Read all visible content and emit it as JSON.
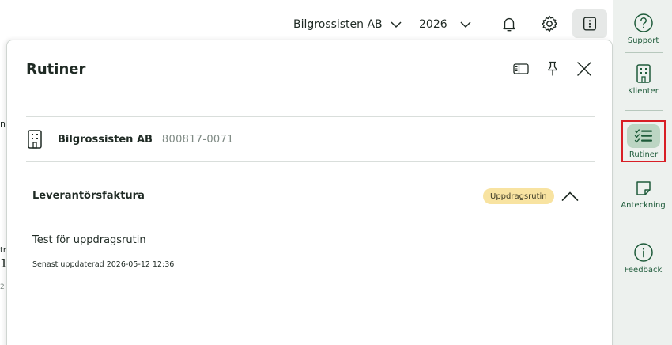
{
  "topbar": {
    "company": "Bilgrossisten AB",
    "year": "2026"
  },
  "background": {
    "fragments": [
      "n",
      "tr",
      "1",
      "2"
    ]
  },
  "rail": {
    "items": [
      {
        "label": "Support",
        "icon": "question-circle-icon"
      },
      {
        "label": "Klienter",
        "icon": "building-icon"
      },
      {
        "label": "Rutiner",
        "icon": "checklist-icon",
        "active": true
      },
      {
        "label": "Anteckning",
        "icon": "note-icon"
      },
      {
        "label": "Feedback",
        "icon": "info-circle-icon"
      }
    ]
  },
  "panel": {
    "title": "Rutiner",
    "client": {
      "name": "Bilgrossisten AB",
      "org_number": "800817-0071"
    },
    "routine": {
      "title": "Leverantörsfaktura",
      "badge": "Uppdragsrutin",
      "text": "Test för uppdragsrutin",
      "updated": "Senast uppdaterad 2026-05-12 12:36"
    }
  },
  "colors": {
    "brand": "#1e5b3a",
    "rail_bg": "#edf1ee",
    "active_pill": "#bcd5c3",
    "badge_bg": "#f8e3a1",
    "highlight": "#d81f26"
  }
}
